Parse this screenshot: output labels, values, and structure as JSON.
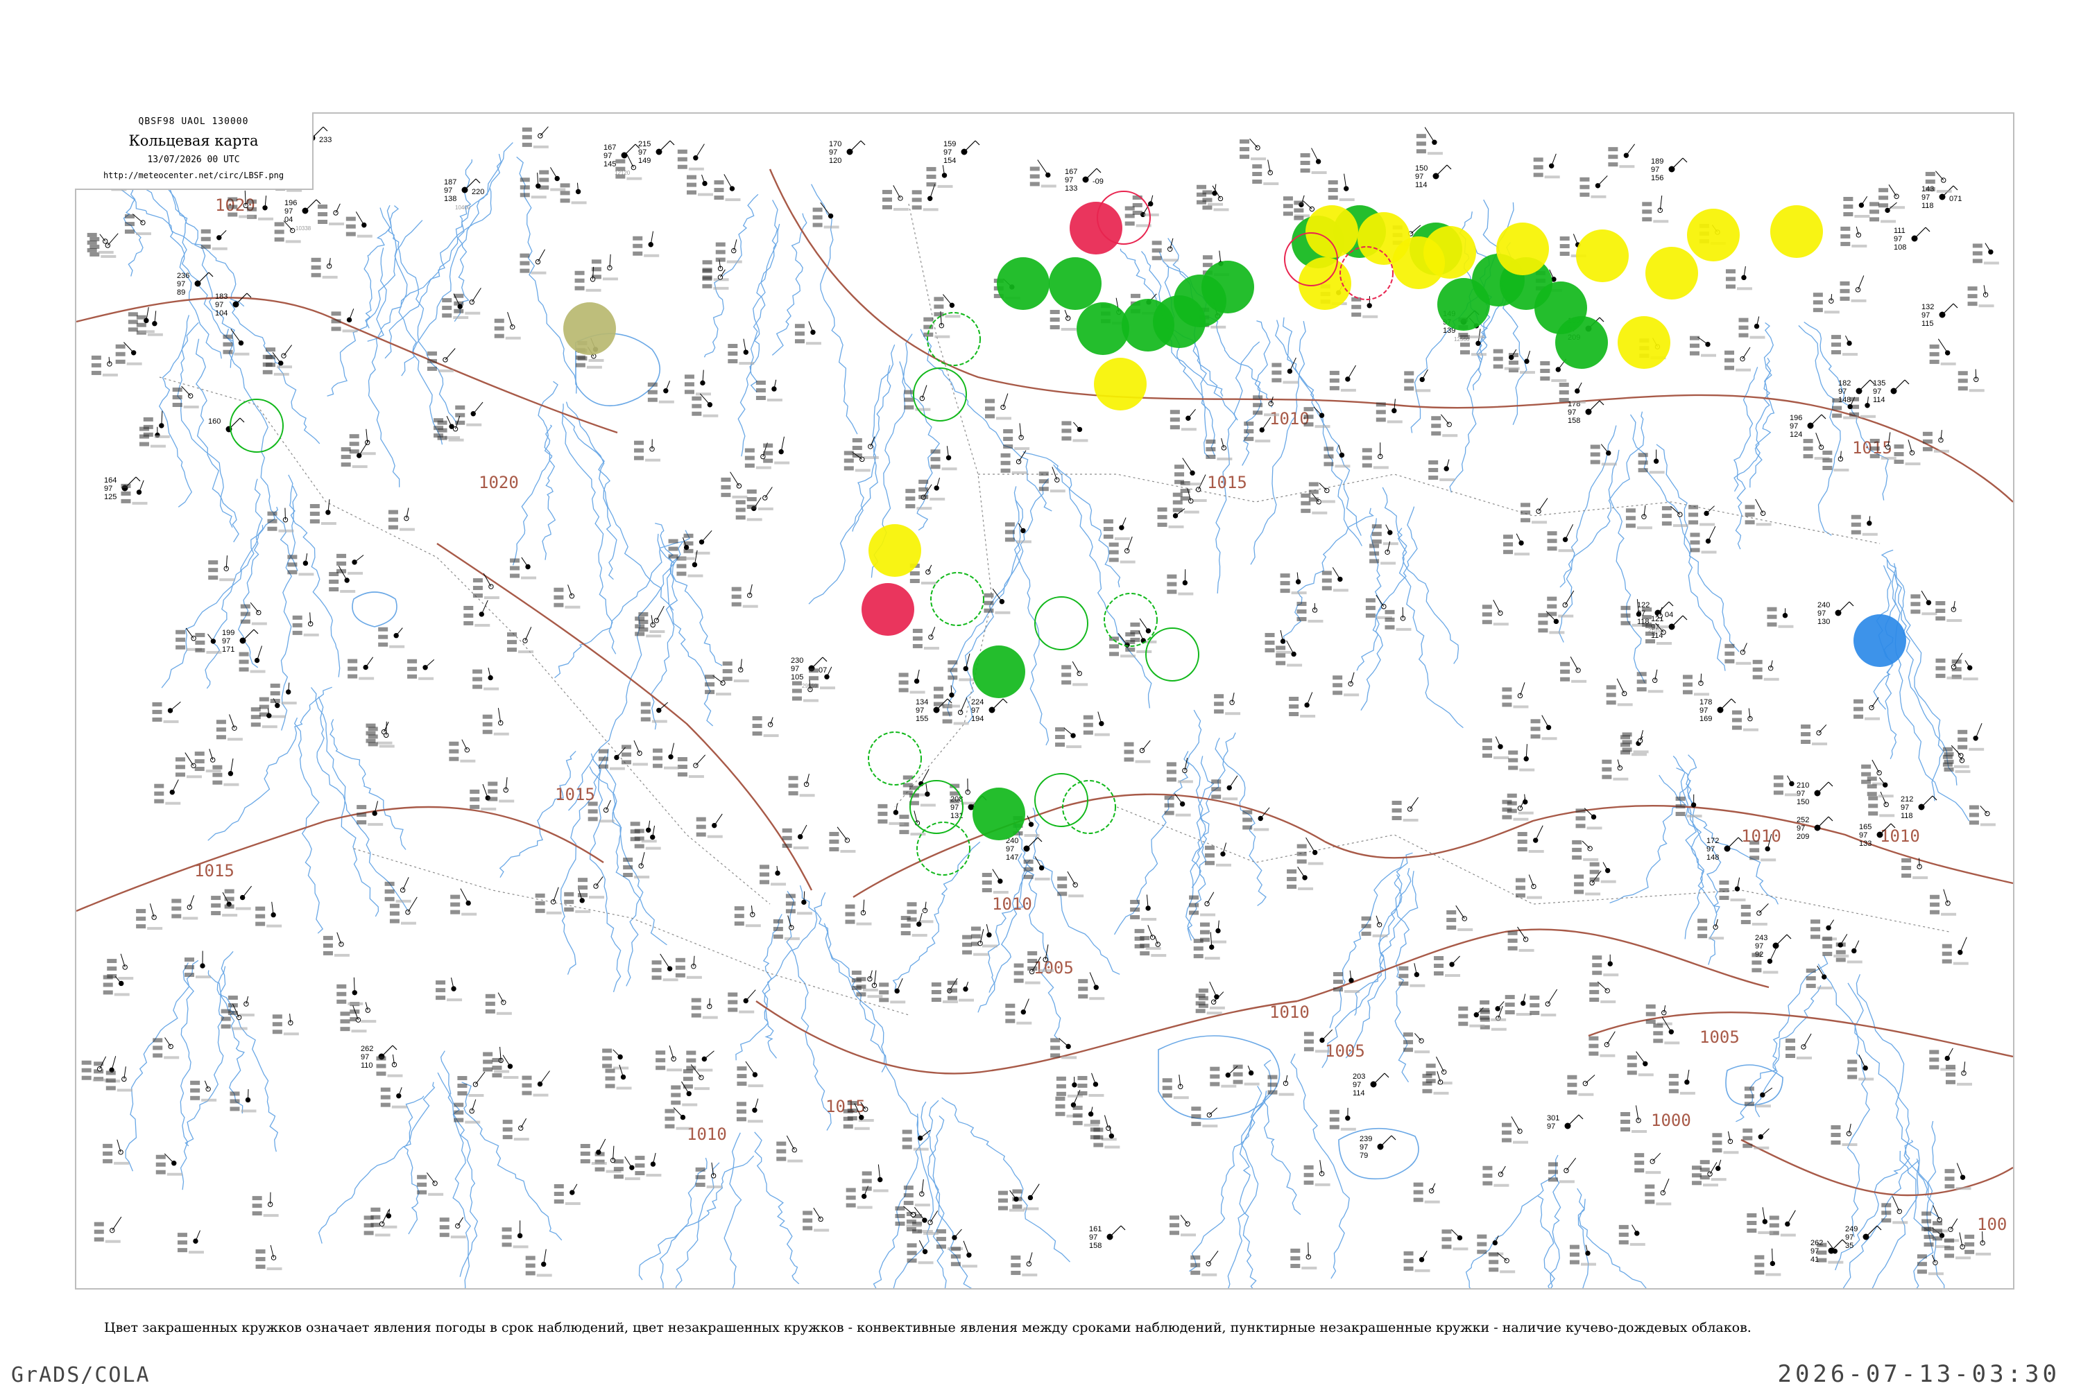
{
  "header": {
    "code": "QBSF98  UAOL  130000",
    "title": "Кольцевая карта",
    "time": "13/07/2026 00 UTC",
    "url": "http://meteocenter.net/circ/LBSF.png"
  },
  "legend": "Цвет закрашенных кружков означает явления погоды в срок наблюдений, цвет незакрашенных кружков - конвективные явления между сроками наблюдений, пунктирные незакрашенные кружки - наличие кучево-дождевых облаков.",
  "footer": {
    "left": "GrADS/COLA",
    "right": "2026-07-13-03:30"
  },
  "colors": {
    "isobar": "#a85a48",
    "river": "#6aa8e6",
    "border": "#8a8a8a",
    "rain": "#11b81b",
    "shower": "#f7f300",
    "storm": "#e8244f",
    "fog": "#b8b870",
    "snow": "#2d8ae8"
  },
  "isobars": [
    {
      "label": "1020"
    },
    {
      "label": "1020"
    },
    {
      "label": "1015"
    },
    {
      "label": "1015"
    },
    {
      "label": "1015"
    },
    {
      "label": "1015"
    },
    {
      "label": "1015"
    },
    {
      "label": "1010"
    },
    {
      "label": "1010"
    },
    {
      "label": "1010"
    },
    {
      "label": "1010"
    },
    {
      "label": "1010"
    },
    {
      "label": "1010"
    },
    {
      "label": "1005"
    },
    {
      "label": "1005"
    },
    {
      "label": "1005"
    },
    {
      "label": "1000"
    },
    {
      "label": "100"
    }
  ],
  "stations": [
    {
      "top": "149",
      "mid": "97",
      "right": "233",
      "bottom": "113",
      "id": ""
    },
    {
      "top": "196",
      "mid": "97",
      "right": "",
      "bottom": "04",
      "id": "10338"
    },
    {
      "top": "187",
      "mid": "97",
      "right": "220",
      "bottom": "138",
      "id": "10400"
    },
    {
      "top": "183",
      "mid": "97",
      "right": "",
      "bottom": "104",
      "id": ""
    },
    {
      "top": "236",
      "mid": "97",
      "right": "",
      "bottom": "89",
      "id": ""
    },
    {
      "top": "160",
      "mid": "",
      "right": "",
      "bottom": "",
      "id": ""
    },
    {
      "top": "164",
      "mid": "97",
      "right": "",
      "bottom": "125",
      "id": ""
    },
    {
      "top": "167",
      "mid": "97",
      "right": "",
      "bottom": "145",
      "id": "12120"
    },
    {
      "top": "215",
      "mid": "97",
      "right": "",
      "bottom": "149",
      "id": ""
    },
    {
      "top": "170",
      "mid": "97",
      "right": "",
      "bottom": "120",
      "id": ""
    },
    {
      "top": "159",
      "mid": "97",
      "right": "",
      "bottom": "154",
      "id": ""
    },
    {
      "top": "167",
      "mid": "97",
      "right": "-09",
      "bottom": "133",
      "id": ""
    },
    {
      "top": "150",
      "mid": "97",
      "right": "",
      "bottom": "114",
      "id": ""
    },
    {
      "top": "149",
      "mid": "97",
      "right": "",
      "bottom": "139",
      "id": "12566"
    },
    {
      "top": "121",
      "mid": "97",
      "right": "",
      "bottom": "114",
      "id": ""
    },
    {
      "top": "178",
      "mid": "97",
      "right": "",
      "bottom": "158",
      "id": ""
    },
    {
      "top": "189",
      "mid": "97",
      "right": "",
      "bottom": "156",
      "id": ""
    },
    {
      "top": "185",
      "mid": "97",
      "right": "",
      "bottom": "209",
      "id": ""
    },
    {
      "top": "182",
      "mid": "97",
      "right": "",
      "bottom": "148",
      "id": ""
    },
    {
      "top": "135",
      "mid": "97",
      "right": "",
      "bottom": "114",
      "id": ""
    },
    {
      "top": "122",
      "mid": "97",
      "right": "04",
      "bottom": "118",
      "id": "27553"
    },
    {
      "top": "111",
      "mid": "97",
      "right": "",
      "bottom": "108",
      "id": ""
    },
    {
      "top": "132",
      "mid": "97",
      "right": "",
      "bottom": "115",
      "id": ""
    },
    {
      "top": "165",
      "mid": "97",
      "right": "",
      "bottom": "133",
      "id": ""
    },
    {
      "top": "230",
      "mid": "97",
      "right": "07",
      "bottom": "105",
      "id": "29559"
    },
    {
      "top": "196",
      "mid": "97",
      "right": "",
      "bottom": "124",
      "id": ""
    },
    {
      "top": "143",
      "mid": "97",
      "right": "071",
      "bottom": "118",
      "id": ""
    },
    {
      "top": "240",
      "mid": "97",
      "right": "",
      "bottom": "130",
      "id": ""
    },
    {
      "top": "210",
      "mid": "97",
      "right": "",
      "bottom": "150",
      "id": ""
    },
    {
      "top": "243",
      "mid": "97",
      "right": "",
      "bottom": "92",
      "id": ""
    },
    {
      "top": "208",
      "mid": "97",
      "right": "",
      "bottom": "131",
      "id": ""
    },
    {
      "top": "134",
      "mid": "97",
      "right": "",
      "bottom": "155",
      "id": ""
    },
    {
      "top": "212",
      "mid": "97",
      "right": "",
      "bottom": "118",
      "id": ""
    },
    {
      "top": "172",
      "mid": "97",
      "right": "",
      "bottom": "148",
      "id": ""
    },
    {
      "top": "252",
      "mid": "97",
      "right": "",
      "bottom": "209",
      "id": ""
    },
    {
      "top": "262",
      "mid": "97",
      "right": "",
      "bottom": "41",
      "id": ""
    },
    {
      "top": "249",
      "mid": "97",
      "right": "",
      "bottom": "35",
      "id": ""
    },
    {
      "top": "178",
      "mid": "97",
      "right": "",
      "bottom": "169",
      "id": ""
    },
    {
      "top": "224",
      "mid": "97",
      "right": "",
      "bottom": "194",
      "id": ""
    },
    {
      "top": "199",
      "mid": "97",
      "right": "",
      "bottom": "171",
      "id": ""
    },
    {
      "top": "240",
      "mid": "97",
      "right": "",
      "bottom": "147",
      "id": ""
    },
    {
      "top": "262",
      "mid": "97",
      "right": "",
      "bottom": "110",
      "id": ""
    },
    {
      "top": "239",
      "mid": "97",
      "right": "",
      "bottom": "79",
      "id": ""
    },
    {
      "top": "161",
      "mid": "97",
      "right": "",
      "bottom": "158",
      "id": ""
    },
    {
      "top": "203",
      "mid": "97",
      "right": "",
      "bottom": "114",
      "id": ""
    },
    {
      "top": "301",
      "mid": "97",
      "right": "",
      "bottom": "",
      "id": ""
    }
  ],
  "weather_circles": [
    {
      "type": "rain",
      "outline": false
    },
    {
      "type": "rain",
      "outline": false
    },
    {
      "type": "rain",
      "outline": false
    },
    {
      "type": "rain",
      "outline": false
    },
    {
      "type": "rain",
      "outline": false
    },
    {
      "type": "rain",
      "outline": false
    },
    {
      "type": "rain",
      "outline": false
    },
    {
      "type": "rain",
      "outline": false
    },
    {
      "type": "rain",
      "outline": false
    },
    {
      "type": "rain",
      "outline": false
    },
    {
      "type": "rain",
      "outline": false
    },
    {
      "type": "rain",
      "outline": false
    },
    {
      "type": "rain",
      "outline": false
    },
    {
      "type": "rain",
      "outline": false
    },
    {
      "type": "rain",
      "outline": false
    },
    {
      "type": "rain",
      "outline": false
    },
    {
      "type": "rain",
      "outline": false
    },
    {
      "type": "shower",
      "outline": false
    },
    {
      "type": "shower",
      "outline": false
    },
    {
      "type": "shower",
      "outline": false
    },
    {
      "type": "shower",
      "outline": false
    },
    {
      "type": "shower",
      "outline": false
    },
    {
      "type": "shower",
      "outline": false
    },
    {
      "type": "shower",
      "outline": false
    },
    {
      "type": "shower",
      "outline": false
    },
    {
      "type": "shower",
      "outline": false
    },
    {
      "type": "shower",
      "outline": false
    },
    {
      "type": "shower",
      "outline": false
    },
    {
      "type": "shower",
      "outline": false
    },
    {
      "type": "shower",
      "outline": false
    },
    {
      "type": "storm",
      "outline": false
    },
    {
      "type": "storm",
      "outline": false
    },
    {
      "type": "snow",
      "outline": false
    },
    {
      "type": "fog",
      "outline": false
    },
    {
      "type": "rain",
      "outline": true
    },
    {
      "type": "rain",
      "outline": true
    },
    {
      "type": "rain",
      "outline": true
    },
    {
      "type": "rain",
      "outline": true
    },
    {
      "type": "rain",
      "outline": true
    },
    {
      "type": "rain",
      "outline": true
    },
    {
      "type": "rain",
      "outline": true
    },
    {
      "type": "rain",
      "outline": true
    },
    {
      "type": "rain",
      "outline": true
    },
    {
      "type": "rain",
      "outline": true
    },
    {
      "type": "rain",
      "outline": true
    },
    {
      "type": "rain",
      "outline": true
    },
    {
      "type": "storm",
      "outline": true
    },
    {
      "type": "storm",
      "outline": true
    },
    {
      "type": "storm",
      "outline": true
    }
  ]
}
